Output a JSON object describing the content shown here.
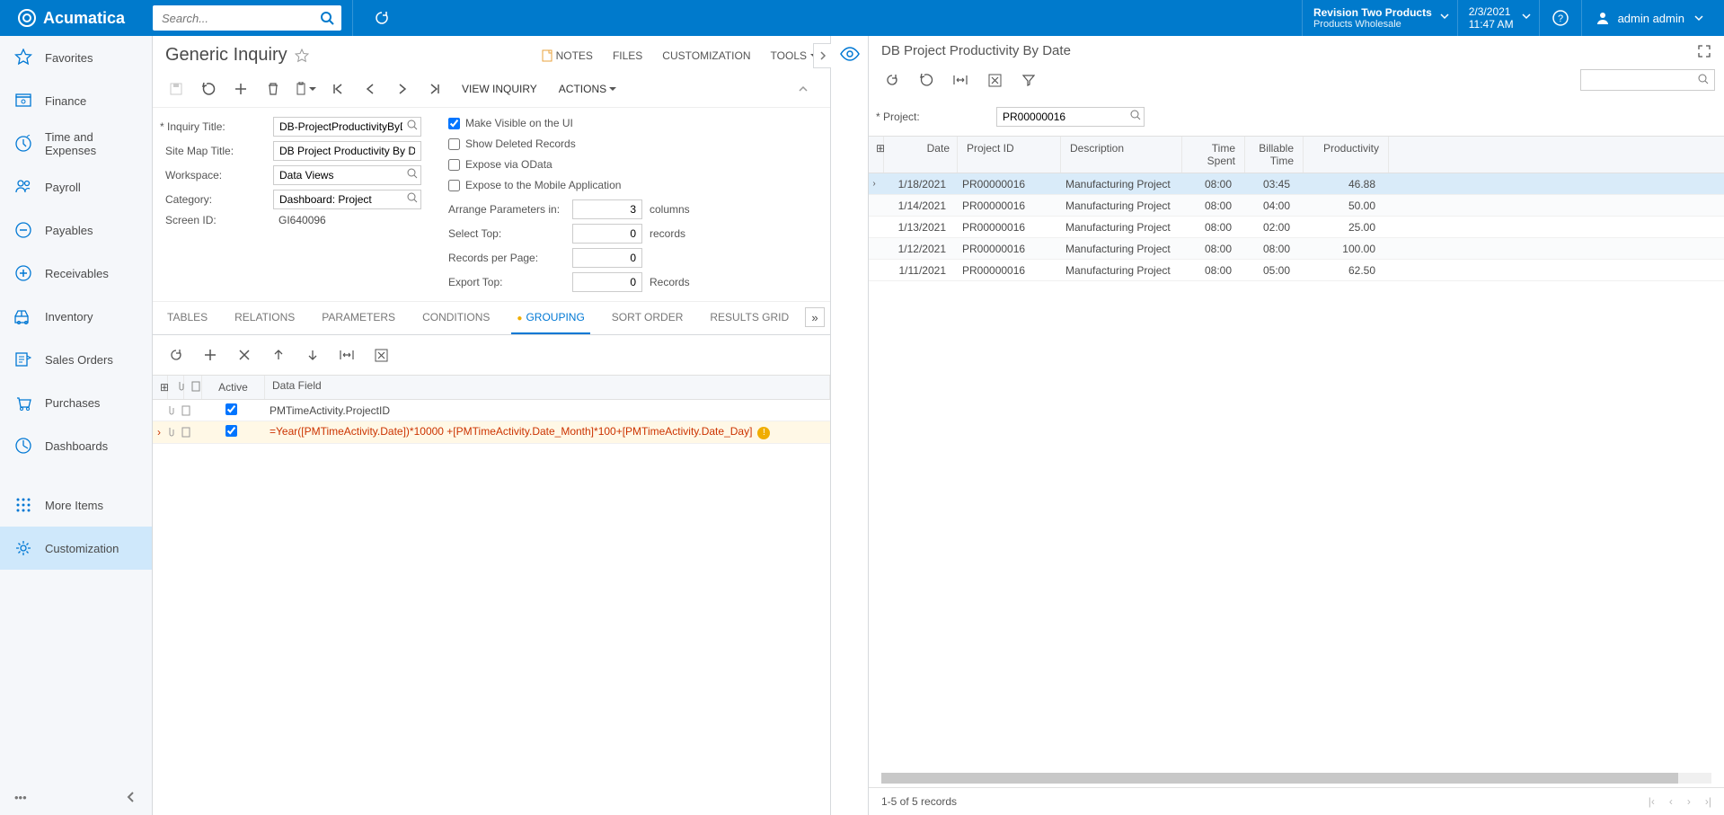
{
  "brand": "Acumatica",
  "search_placeholder": "Search...",
  "tenant": {
    "line1": "Revision Two Products",
    "line2": "Products Wholesale"
  },
  "datetime": {
    "date": "2/3/2021",
    "time": "11:47 AM"
  },
  "user": "admin admin",
  "sidebar": [
    {
      "label": "Favorites"
    },
    {
      "label": "Finance"
    },
    {
      "label": "Time and Expenses"
    },
    {
      "label": "Payroll"
    },
    {
      "label": "Payables"
    },
    {
      "label": "Receivables"
    },
    {
      "label": "Inventory"
    },
    {
      "label": "Sales Orders"
    },
    {
      "label": "Purchases"
    },
    {
      "label": "Dashboards"
    },
    {
      "label": "More Items"
    },
    {
      "label": "Customization"
    }
  ],
  "page_title": "Generic Inquiry",
  "header_links": {
    "notes": "NOTES",
    "files": "FILES",
    "customization": "CUSTOMIZATION",
    "tools": "TOOLS"
  },
  "toolbar_text": {
    "view": "VIEW INQUIRY",
    "actions": "ACTIONS"
  },
  "form": {
    "inquiry_title_label": "Inquiry Title:",
    "inquiry_title": "DB-ProjectProductivityByDate",
    "site_map_label": "Site Map Title:",
    "site_map": "DB Project Productivity By Date",
    "workspace_label": "Workspace:",
    "workspace": "Data Views",
    "category_label": "Category:",
    "category": "Dashboard: Project",
    "screen_id_label": "Screen ID:",
    "screen_id": "GI640096",
    "chk_visible": "Make Visible on the UI",
    "chk_deleted": "Show Deleted Records",
    "chk_odata": "Expose via OData",
    "chk_mobile": "Expose to the Mobile Application",
    "arrange_label": "Arrange Parameters in:",
    "arrange_val": "3",
    "arrange_unit": "columns",
    "select_top_label": "Select Top:",
    "select_top_val": "0",
    "select_top_unit": "records",
    "rpp_label": "Records per Page:",
    "rpp_val": "0",
    "export_label": "Export Top:",
    "export_val": "0",
    "export_unit": "Records"
  },
  "tabs": [
    "TABLES",
    "RELATIONS",
    "PARAMETERS",
    "CONDITIONS",
    "GROUPING",
    "SORT ORDER",
    "RESULTS GRID"
  ],
  "grid": {
    "col_active": "Active",
    "col_field": "Data Field",
    "rows": [
      {
        "active": true,
        "field": "PMTimeActivity.ProjectID",
        "err": false
      },
      {
        "active": true,
        "field": "=Year([PMTimeActivity.Date])*10000 +[PMTimeActivity.Date_Month]*100+[PMTimeActivity.Date_Day]",
        "err": true
      }
    ]
  },
  "right": {
    "title": "DB Project Productivity By Date",
    "project_label": "Project:",
    "project_val": "PR00000016",
    "cols": {
      "date": "Date",
      "pid": "Project ID",
      "desc": "Description",
      "ts": "Time Spent",
      "bt": "Billable Time",
      "prod": "Productivity"
    },
    "rows": [
      {
        "date": "1/18/2021",
        "pid": "PR00000016",
        "desc": "Manufacturing Project",
        "ts": "08:00",
        "bt": "03:45",
        "prod": "46.88"
      },
      {
        "date": "1/14/2021",
        "pid": "PR00000016",
        "desc": "Manufacturing Project",
        "ts": "08:00",
        "bt": "04:00",
        "prod": "50.00"
      },
      {
        "date": "1/13/2021",
        "pid": "PR00000016",
        "desc": "Manufacturing Project",
        "ts": "08:00",
        "bt": "02:00",
        "prod": "25.00"
      },
      {
        "date": "1/12/2021",
        "pid": "PR00000016",
        "desc": "Manufacturing Project",
        "ts": "08:00",
        "bt": "08:00",
        "prod": "100.00"
      },
      {
        "date": "1/11/2021",
        "pid": "PR00000016",
        "desc": "Manufacturing Project",
        "ts": "08:00",
        "bt": "05:00",
        "prod": "62.50"
      }
    ],
    "pager_text": "1-5 of 5 records"
  }
}
